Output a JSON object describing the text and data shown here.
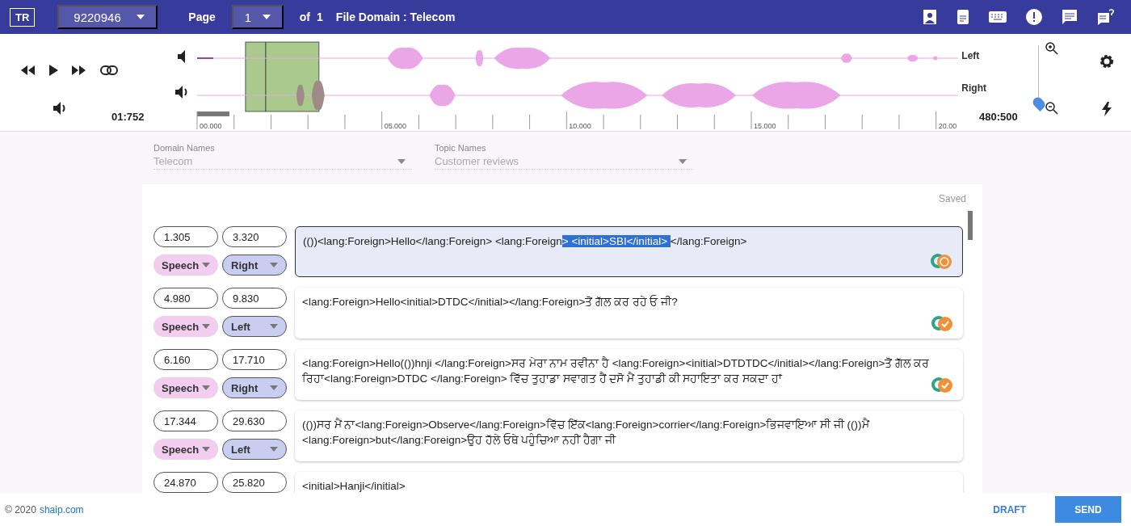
{
  "header": {
    "badge": "TR",
    "file_select": "9220946",
    "page_label": "Page",
    "page_select": "1",
    "of_label": "of",
    "page_count": "1",
    "file_domain": "File Domain : Telecom"
  },
  "player": {
    "time": "01:752",
    "channels": [
      {
        "label": "Left"
      },
      {
        "label": "Right"
      }
    ],
    "tick_labels": [
      "00.000",
      "05.000",
      "10.000",
      "15.000",
      "20.00"
    ],
    "zoom": {
      "level": 0.05
    },
    "ratio": "480:500"
  },
  "filters": [
    {
      "label": "Domain Names",
      "value": "Telecom"
    },
    {
      "label": "Topic Names",
      "value": "Customer reviews"
    }
  ],
  "save_state": "Saved",
  "segments": [
    {
      "start": "1.305",
      "end": "3.320",
      "type": "Speech",
      "channel": "Right",
      "selected": true,
      "kind": "pending",
      "text_parts": [
        {
          "text": "(())<lang:Foreign>Hello</lang:Foreign> <lang:Foreign",
          "highlighted": false
        },
        {
          "text": "> <initial>SBI</initial> ",
          "highlighted": true
        },
        {
          "text": "</lang:Foreign>",
          "highlighted": false
        }
      ]
    },
    {
      "start": "4.980",
      "end": "9.830",
      "type": "Speech",
      "channel": "Left",
      "selected": false,
      "kind": "confirmed",
      "text_parts": [
        {
          "text": "<lang:Foreign>Hello<initial>DTDC</initial></lang:Foreign>ਤੋਂ ਗੱਲ ਕਰ ਰਹੇ ਓ ਜੀ?",
          "highlighted": false
        }
      ]
    },
    {
      "start": "6.160",
      "end": "17.710",
      "type": "Speech",
      "channel": "Right",
      "selected": false,
      "kind": "confirmed",
      "text_parts": [
        {
          "text": "<lang:Foreign>Hello(())hnji </lang:Foreign>ਸਰ ਮੇਰਾ ਨਾਮ ਰਵੀਨਾ ਹੈ <lang:Foreign><initial>DTDTDC</initial></lang:Foreign>ਤੋਂ ਗੱਲ ਕਰ ਰਿਹਾ<lang:Foreign>DTDC </lang:Foreign> ਵਿੱਚ ਤੁਹਾਡਾ ਸਵਾਗਤ ਹੈਂ ਦਸੋ ਮੈਂ ਤੁਹਾਡੀ ਕੀ ਸਹਾਇਤਾ ਕਰ ਸਕਦਾ ਹਾਂ",
          "highlighted": false
        }
      ]
    },
    {
      "start": "17.344",
      "end": "29.630",
      "type": "Speech",
      "channel": "Left",
      "selected": false,
      "kind": "plain",
      "text_parts": [
        {
          "text": "(())ਸਰ ਮੈਂ ਨਾ<lang:Foreign>Observe</lang:Foreign>ਵਿੱਚ ਇੱਕ<lang:Foreign>corrier</lang:Foreign>ਭਿਜਵਾਇਆ ਸੀ ਜੀ (())ਮੈਂ <lang:Foreign>but</lang:Foreign>ਉਹ ਹੱਲੇ ਓਥੇ ਪਹੁੰਚਿਆ ਨਹੀਂ ਹੈਗਾ ਜੀ",
          "highlighted": false
        }
      ]
    },
    {
      "start": "24.870",
      "end": "25.820",
      "selected": false,
      "kind": "plain",
      "text_parts": [
        {
          "text": "<initial>Hanji</initial>",
          "highlighted": false
        }
      ]
    }
  ],
  "footer": {
    "copyright": "© 2020",
    "link": "shaip.com",
    "draft": "DRAFT",
    "send": "SEND"
  }
}
